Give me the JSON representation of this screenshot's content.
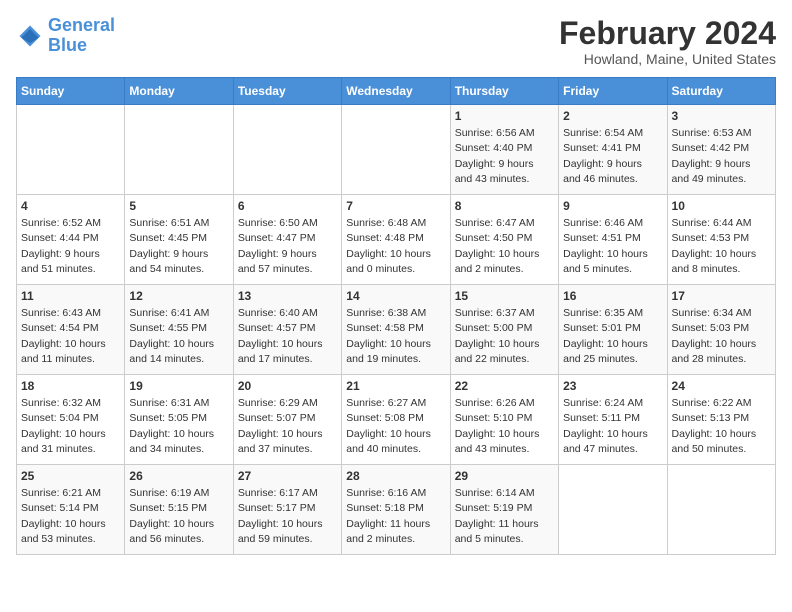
{
  "header": {
    "logo_line1": "General",
    "logo_line2": "Blue",
    "month_title": "February 2024",
    "location": "Howland, Maine, United States"
  },
  "weekdays": [
    "Sunday",
    "Monday",
    "Tuesday",
    "Wednesday",
    "Thursday",
    "Friday",
    "Saturday"
  ],
  "weeks": [
    [
      {
        "num": "",
        "detail": ""
      },
      {
        "num": "",
        "detail": ""
      },
      {
        "num": "",
        "detail": ""
      },
      {
        "num": "",
        "detail": ""
      },
      {
        "num": "1",
        "detail": "Sunrise: 6:56 AM\nSunset: 4:40 PM\nDaylight: 9 hours\nand 43 minutes."
      },
      {
        "num": "2",
        "detail": "Sunrise: 6:54 AM\nSunset: 4:41 PM\nDaylight: 9 hours\nand 46 minutes."
      },
      {
        "num": "3",
        "detail": "Sunrise: 6:53 AM\nSunset: 4:42 PM\nDaylight: 9 hours\nand 49 minutes."
      }
    ],
    [
      {
        "num": "4",
        "detail": "Sunrise: 6:52 AM\nSunset: 4:44 PM\nDaylight: 9 hours\nand 51 minutes."
      },
      {
        "num": "5",
        "detail": "Sunrise: 6:51 AM\nSunset: 4:45 PM\nDaylight: 9 hours\nand 54 minutes."
      },
      {
        "num": "6",
        "detail": "Sunrise: 6:50 AM\nSunset: 4:47 PM\nDaylight: 9 hours\nand 57 minutes."
      },
      {
        "num": "7",
        "detail": "Sunrise: 6:48 AM\nSunset: 4:48 PM\nDaylight: 10 hours\nand 0 minutes."
      },
      {
        "num": "8",
        "detail": "Sunrise: 6:47 AM\nSunset: 4:50 PM\nDaylight: 10 hours\nand 2 minutes."
      },
      {
        "num": "9",
        "detail": "Sunrise: 6:46 AM\nSunset: 4:51 PM\nDaylight: 10 hours\nand 5 minutes."
      },
      {
        "num": "10",
        "detail": "Sunrise: 6:44 AM\nSunset: 4:53 PM\nDaylight: 10 hours\nand 8 minutes."
      }
    ],
    [
      {
        "num": "11",
        "detail": "Sunrise: 6:43 AM\nSunset: 4:54 PM\nDaylight: 10 hours\nand 11 minutes."
      },
      {
        "num": "12",
        "detail": "Sunrise: 6:41 AM\nSunset: 4:55 PM\nDaylight: 10 hours\nand 14 minutes."
      },
      {
        "num": "13",
        "detail": "Sunrise: 6:40 AM\nSunset: 4:57 PM\nDaylight: 10 hours\nand 17 minutes."
      },
      {
        "num": "14",
        "detail": "Sunrise: 6:38 AM\nSunset: 4:58 PM\nDaylight: 10 hours\nand 19 minutes."
      },
      {
        "num": "15",
        "detail": "Sunrise: 6:37 AM\nSunset: 5:00 PM\nDaylight: 10 hours\nand 22 minutes."
      },
      {
        "num": "16",
        "detail": "Sunrise: 6:35 AM\nSunset: 5:01 PM\nDaylight: 10 hours\nand 25 minutes."
      },
      {
        "num": "17",
        "detail": "Sunrise: 6:34 AM\nSunset: 5:03 PM\nDaylight: 10 hours\nand 28 minutes."
      }
    ],
    [
      {
        "num": "18",
        "detail": "Sunrise: 6:32 AM\nSunset: 5:04 PM\nDaylight: 10 hours\nand 31 minutes."
      },
      {
        "num": "19",
        "detail": "Sunrise: 6:31 AM\nSunset: 5:05 PM\nDaylight: 10 hours\nand 34 minutes."
      },
      {
        "num": "20",
        "detail": "Sunrise: 6:29 AM\nSunset: 5:07 PM\nDaylight: 10 hours\nand 37 minutes."
      },
      {
        "num": "21",
        "detail": "Sunrise: 6:27 AM\nSunset: 5:08 PM\nDaylight: 10 hours\nand 40 minutes."
      },
      {
        "num": "22",
        "detail": "Sunrise: 6:26 AM\nSunset: 5:10 PM\nDaylight: 10 hours\nand 43 minutes."
      },
      {
        "num": "23",
        "detail": "Sunrise: 6:24 AM\nSunset: 5:11 PM\nDaylight: 10 hours\nand 47 minutes."
      },
      {
        "num": "24",
        "detail": "Sunrise: 6:22 AM\nSunset: 5:13 PM\nDaylight: 10 hours\nand 50 minutes."
      }
    ],
    [
      {
        "num": "25",
        "detail": "Sunrise: 6:21 AM\nSunset: 5:14 PM\nDaylight: 10 hours\nand 53 minutes."
      },
      {
        "num": "26",
        "detail": "Sunrise: 6:19 AM\nSunset: 5:15 PM\nDaylight: 10 hours\nand 56 minutes."
      },
      {
        "num": "27",
        "detail": "Sunrise: 6:17 AM\nSunset: 5:17 PM\nDaylight: 10 hours\nand 59 minutes."
      },
      {
        "num": "28",
        "detail": "Sunrise: 6:16 AM\nSunset: 5:18 PM\nDaylight: 11 hours\nand 2 minutes."
      },
      {
        "num": "29",
        "detail": "Sunrise: 6:14 AM\nSunset: 5:19 PM\nDaylight: 11 hours\nand 5 minutes."
      },
      {
        "num": "",
        "detail": ""
      },
      {
        "num": "",
        "detail": ""
      }
    ]
  ]
}
